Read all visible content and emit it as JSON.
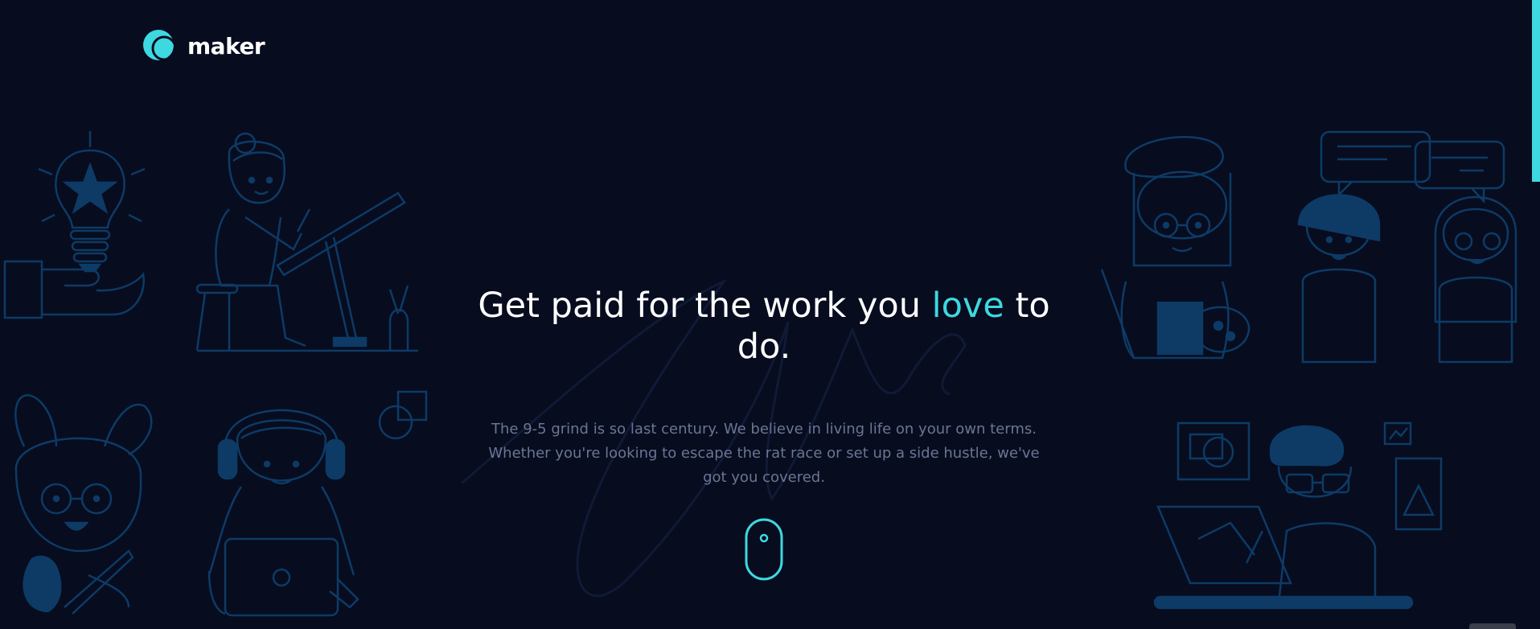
{
  "brand": {
    "name": "maker",
    "accent_color": "#3ed8e0",
    "illustration_color": "#0d3b66",
    "background_color": "#070c1f"
  },
  "hero": {
    "title_part1": "Get paid for the work you ",
    "title_accent": "love",
    "title_part2": " to do.",
    "subtitle": "The 9-5 grind is so last century. We believe in living life on your own terms. Whether you're looking to escape the rat race or set up a side hustle, we've got you covered."
  },
  "icons": {
    "logo": "logo-mark-icon",
    "scroll": "mouse-scroll-icon"
  }
}
